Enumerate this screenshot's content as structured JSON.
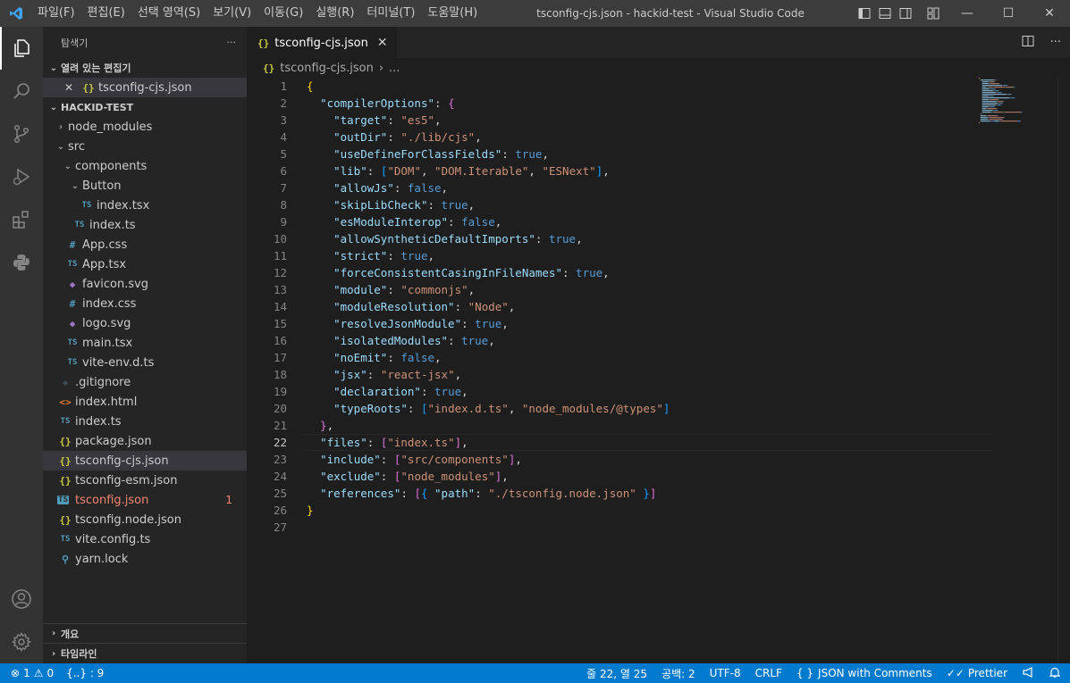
{
  "titlebar": {
    "menu": [
      "파일(F)",
      "편집(E)",
      "선택 영역(S)",
      "보기(V)",
      "이동(G)",
      "실행(R)",
      "터미널(T)",
      "도움말(H)"
    ],
    "title": "tsconfig-cjs.json - hackid-test - Visual Studio Code",
    "minimize": "—",
    "maximize": "☐",
    "close": "✕"
  },
  "sidebar": {
    "header": "탐색기",
    "more": "···",
    "open_editors": {
      "label": "열려 있는 편집기",
      "items": [
        {
          "close": "✕",
          "icon": "{}",
          "label": "tsconfig-cjs.json"
        }
      ]
    },
    "project": {
      "label": "HACKID-TEST",
      "items": [
        {
          "depth": 0,
          "chevron": "›",
          "icon": "",
          "label": "node_modules",
          "type": "folder"
        },
        {
          "depth": 0,
          "chevron": "⌄",
          "icon": "",
          "label": "src",
          "type": "folder"
        },
        {
          "depth": 1,
          "chevron": "⌄",
          "icon": "",
          "label": "components",
          "type": "folder"
        },
        {
          "depth": 2,
          "chevron": "⌄",
          "icon": "",
          "label": "Button",
          "type": "folder"
        },
        {
          "depth": 3,
          "chevron": "",
          "icon": "TS",
          "label": "index.tsx",
          "type": "ts"
        },
        {
          "depth": 2,
          "chevron": "",
          "icon": "TS",
          "label": "index.ts",
          "type": "ts"
        },
        {
          "depth": 1,
          "chevron": "",
          "icon": "#",
          "label": "App.css",
          "type": "css"
        },
        {
          "depth": 1,
          "chevron": "",
          "icon": "TS",
          "label": "App.tsx",
          "type": "ts"
        },
        {
          "depth": 1,
          "chevron": "",
          "icon": "◆",
          "label": "favicon.svg",
          "type": "svg"
        },
        {
          "depth": 1,
          "chevron": "",
          "icon": "#",
          "label": "index.css",
          "type": "css"
        },
        {
          "depth": 1,
          "chevron": "",
          "icon": "◆",
          "label": "logo.svg",
          "type": "svg"
        },
        {
          "depth": 1,
          "chevron": "",
          "icon": "TS",
          "label": "main.tsx",
          "type": "ts"
        },
        {
          "depth": 1,
          "chevron": "",
          "icon": "TS",
          "label": "vite-env.d.ts",
          "type": "ts"
        },
        {
          "depth": 0,
          "chevron": "",
          "icon": "◈",
          "label": ".gitignore",
          "type": "git"
        },
        {
          "depth": 0,
          "chevron": "",
          "icon": "<>",
          "label": "index.html",
          "type": "html"
        },
        {
          "depth": 0,
          "chevron": "",
          "icon": "TS",
          "label": "index.ts",
          "type": "ts"
        },
        {
          "depth": 0,
          "chevron": "",
          "icon": "{}",
          "label": "package.json",
          "type": "json"
        },
        {
          "depth": 0,
          "chevron": "",
          "icon": "{}",
          "label": "tsconfig-cjs.json",
          "type": "json",
          "selected": true
        },
        {
          "depth": 0,
          "chevron": "",
          "icon": "{}",
          "label": "tsconfig-esm.json",
          "type": "json"
        },
        {
          "depth": 0,
          "chevron": "",
          "icon": "TS",
          "label": "tsconfig.json",
          "type": "tsconfig",
          "badge": "1"
        },
        {
          "depth": 0,
          "chevron": "",
          "icon": "{}",
          "label": "tsconfig.node.json",
          "type": "json"
        },
        {
          "depth": 0,
          "chevron": "",
          "icon": "TS",
          "label": "vite.config.ts",
          "type": "ts"
        },
        {
          "depth": 0,
          "chevron": "",
          "icon": "⚲",
          "label": "yarn.lock",
          "type": "yarn"
        }
      ]
    },
    "outline": "개요",
    "timeline": "타임라인"
  },
  "editor": {
    "tab": {
      "icon": "{}",
      "label": "tsconfig-cjs.json",
      "close": "✕"
    },
    "breadcrumb": {
      "icon": "{}",
      "file": "tsconfig-cjs.json",
      "rest": "..."
    },
    "current_line": 22,
    "lines": [
      [
        [
          "br1",
          "{"
        ]
      ],
      [
        [
          "p",
          "  "
        ],
        [
          "k",
          "\"compilerOptions\""
        ],
        [
          "p",
          ": "
        ],
        [
          "br2",
          "{"
        ]
      ],
      [
        [
          "p",
          "    "
        ],
        [
          "k",
          "\"target\""
        ],
        [
          "p",
          ": "
        ],
        [
          "s",
          "\"es5\""
        ],
        [
          "p",
          ","
        ]
      ],
      [
        [
          "p",
          "    "
        ],
        [
          "k",
          "\"outDir\""
        ],
        [
          "p",
          ": "
        ],
        [
          "s",
          "\"./lib/cjs\""
        ],
        [
          "p",
          ","
        ]
      ],
      [
        [
          "p",
          "    "
        ],
        [
          "k",
          "\"useDefineForClassFields\""
        ],
        [
          "p",
          ": "
        ],
        [
          "b",
          "true"
        ],
        [
          "p",
          ","
        ]
      ],
      [
        [
          "p",
          "    "
        ],
        [
          "k",
          "\"lib\""
        ],
        [
          "p",
          ": "
        ],
        [
          "br3",
          "["
        ],
        [
          "s",
          "\"DOM\""
        ],
        [
          "p",
          ", "
        ],
        [
          "s",
          "\"DOM.Iterable\""
        ],
        [
          "p",
          ", "
        ],
        [
          "s",
          "\"ESNext\""
        ],
        [
          "br3",
          "]"
        ],
        [
          "p",
          ","
        ]
      ],
      [
        [
          "p",
          "    "
        ],
        [
          "k",
          "\"allowJs\""
        ],
        [
          "p",
          ": "
        ],
        [
          "b",
          "false"
        ],
        [
          "p",
          ","
        ]
      ],
      [
        [
          "p",
          "    "
        ],
        [
          "k",
          "\"skipLibCheck\""
        ],
        [
          "p",
          ": "
        ],
        [
          "b",
          "true"
        ],
        [
          "p",
          ","
        ]
      ],
      [
        [
          "p",
          "    "
        ],
        [
          "k",
          "\"esModuleInterop\""
        ],
        [
          "p",
          ": "
        ],
        [
          "b",
          "false"
        ],
        [
          "p",
          ","
        ]
      ],
      [
        [
          "p",
          "    "
        ],
        [
          "k",
          "\"allowSyntheticDefaultImports\""
        ],
        [
          "p",
          ": "
        ],
        [
          "b",
          "true"
        ],
        [
          "p",
          ","
        ]
      ],
      [
        [
          "p",
          "    "
        ],
        [
          "k",
          "\"strict\""
        ],
        [
          "p",
          ": "
        ],
        [
          "b",
          "true"
        ],
        [
          "p",
          ","
        ]
      ],
      [
        [
          "p",
          "    "
        ],
        [
          "k",
          "\"forceConsistentCasingInFileNames\""
        ],
        [
          "p",
          ": "
        ],
        [
          "b",
          "true"
        ],
        [
          "p",
          ","
        ]
      ],
      [
        [
          "p",
          "    "
        ],
        [
          "k",
          "\"module\""
        ],
        [
          "p",
          ": "
        ],
        [
          "s",
          "\"commonjs\""
        ],
        [
          "p",
          ","
        ]
      ],
      [
        [
          "p",
          "    "
        ],
        [
          "k",
          "\"moduleResolution\""
        ],
        [
          "p",
          ": "
        ],
        [
          "s",
          "\"Node\""
        ],
        [
          "p",
          ","
        ]
      ],
      [
        [
          "p",
          "    "
        ],
        [
          "k",
          "\"resolveJsonModule\""
        ],
        [
          "p",
          ": "
        ],
        [
          "b",
          "true"
        ],
        [
          "p",
          ","
        ]
      ],
      [
        [
          "p",
          "    "
        ],
        [
          "k",
          "\"isolatedModules\""
        ],
        [
          "p",
          ": "
        ],
        [
          "b",
          "true"
        ],
        [
          "p",
          ","
        ]
      ],
      [
        [
          "p",
          "    "
        ],
        [
          "k",
          "\"noEmit\""
        ],
        [
          "p",
          ": "
        ],
        [
          "b",
          "false"
        ],
        [
          "p",
          ","
        ]
      ],
      [
        [
          "p",
          "    "
        ],
        [
          "k",
          "\"jsx\""
        ],
        [
          "p",
          ": "
        ],
        [
          "s",
          "\"react-jsx\""
        ],
        [
          "p",
          ","
        ]
      ],
      [
        [
          "p",
          "    "
        ],
        [
          "k",
          "\"declaration\""
        ],
        [
          "p",
          ": "
        ],
        [
          "b",
          "true"
        ],
        [
          "p",
          ","
        ]
      ],
      [
        [
          "p",
          "    "
        ],
        [
          "k",
          "\"typeRoots\""
        ],
        [
          "p",
          ": "
        ],
        [
          "br3",
          "["
        ],
        [
          "s",
          "\"index.d.ts\""
        ],
        [
          "p",
          ", "
        ],
        [
          "s",
          "\"node_modules/@types\""
        ],
        [
          "br3",
          "]"
        ]
      ],
      [
        [
          "p",
          "  "
        ],
        [
          "br2",
          "}"
        ],
        [
          "p",
          ","
        ]
      ],
      [
        [
          "p",
          "  "
        ],
        [
          "k",
          "\"files\""
        ],
        [
          "p",
          ": "
        ],
        [
          "br2",
          "["
        ],
        [
          "s",
          "\"index.ts\""
        ],
        [
          "br2",
          "]"
        ],
        [
          "p",
          ","
        ]
      ],
      [
        [
          "p",
          "  "
        ],
        [
          "k",
          "\"include\""
        ],
        [
          "p",
          ": "
        ],
        [
          "br2",
          "["
        ],
        [
          "s",
          "\"src/components\""
        ],
        [
          "br2",
          "]"
        ],
        [
          "p",
          ","
        ]
      ],
      [
        [
          "p",
          "  "
        ],
        [
          "k",
          "\"exclude\""
        ],
        [
          "p",
          ": "
        ],
        [
          "br2",
          "["
        ],
        [
          "s",
          "\"node_modules\""
        ],
        [
          "br2",
          "]"
        ],
        [
          "p",
          ","
        ]
      ],
      [
        [
          "p",
          "  "
        ],
        [
          "k",
          "\"references\""
        ],
        [
          "p",
          ": "
        ],
        [
          "br2",
          "["
        ],
        [
          "br3",
          "{ "
        ],
        [
          "k",
          "\"path\""
        ],
        [
          "p",
          ": "
        ],
        [
          "s",
          "\"./tsconfig.node.json\""
        ],
        [
          "br3",
          " }"
        ],
        [
          "br2",
          "]"
        ]
      ],
      [
        [
          "br1",
          "}"
        ]
      ],
      []
    ]
  },
  "statusbar": {
    "errors": "1",
    "warnings": "0",
    "json_count": "{..} : 9",
    "cursor": "줄 22, 열 25",
    "spaces": "공백: 2",
    "encoding": "UTF-8",
    "eol": "CRLF",
    "language": "JSON with Comments",
    "formatter": "Prettier"
  },
  "colors": {
    "accent": "#007acc",
    "titlebar": "#3c3c3c",
    "activitybar": "#333333",
    "sidebar": "#252526",
    "editor": "#1e1e1e"
  }
}
